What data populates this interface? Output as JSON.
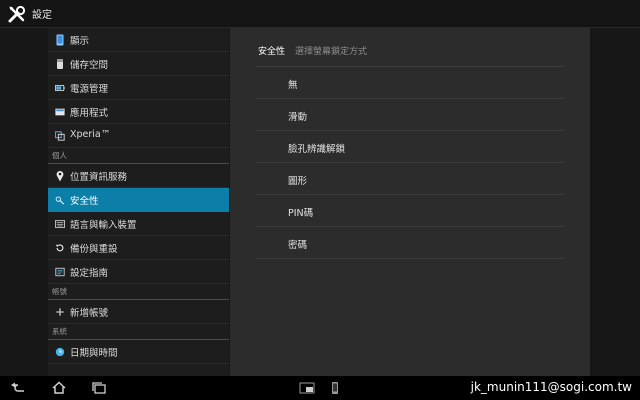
{
  "header": {
    "title": "設定",
    "icon": "tools-icon"
  },
  "sidebar": {
    "items": [
      {
        "label": "顯示",
        "icon": "display-icon"
      },
      {
        "label": "儲存空間",
        "icon": "storage-icon"
      },
      {
        "label": "電源管理",
        "icon": "battery-icon"
      },
      {
        "label": "應用程式",
        "icon": "apps-icon"
      },
      {
        "label": "Xperia™",
        "icon": "xperia-icon"
      },
      {
        "label": "位置資訊服務",
        "icon": "location-icon"
      },
      {
        "label": "安全性",
        "icon": "lock-icon"
      },
      {
        "label": "語言與輸入裝置",
        "icon": "keyboard-icon"
      },
      {
        "label": "備份與重設",
        "icon": "backup-icon"
      },
      {
        "label": "設定指南",
        "icon": "guide-icon"
      },
      {
        "label": "新增帳號",
        "icon": "plus-icon"
      },
      {
        "label": "日期與時間",
        "icon": "clock-icon"
      }
    ],
    "sections": [
      "個人",
      "帳號",
      "系統"
    ]
  },
  "panel": {
    "title": "安全性",
    "subtitle": "選擇螢幕鎖定方式",
    "options": [
      "無",
      "滑動",
      "臉孔辨識解鎖",
      "圖形",
      "PIN碼",
      "密碼"
    ]
  },
  "navbar": {
    "buttons": [
      "back-icon",
      "home-icon",
      "recent-apps-icon",
      "small-app-icon",
      "phone-app-icon"
    ],
    "watermark": "jk_munin111@sogi.com.tw"
  },
  "colors": {
    "accent": "#0b7fa8",
    "background": "#171717",
    "panel": "#2c2c2c",
    "sidebar": "#1d1d1d"
  }
}
